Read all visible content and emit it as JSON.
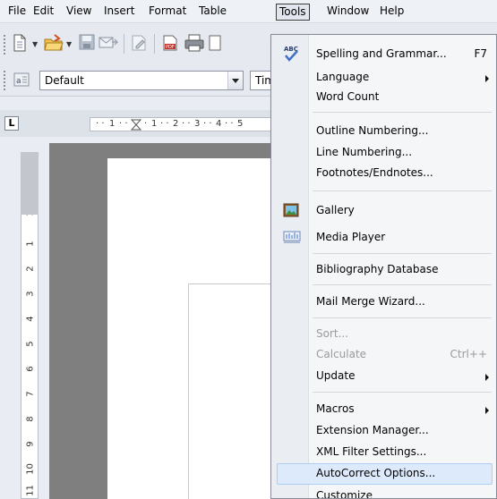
{
  "menubar": {
    "items": [
      "File",
      "Edit",
      "View",
      "Insert",
      "Format",
      "Table",
      "Tools",
      "Window",
      "Help"
    ],
    "active": "Tools"
  },
  "toolbar": {
    "style_value": "Default",
    "font_value": "Times I",
    "icons": [
      "new-document-icon",
      "open-folder-icon",
      "save-icon",
      "email-icon",
      "edit-file-icon",
      "export-pdf-icon",
      "print-icon",
      "spelling-icon"
    ]
  },
  "ruler": {
    "tab_selector": "L",
    "h_labels": [
      "1",
      "1",
      "2",
      "3",
      "4",
      "5"
    ],
    "v_labels": [
      "1",
      "1",
      "2",
      "3",
      "4",
      "5",
      "6",
      "7",
      "8",
      "9",
      "10",
      "11"
    ]
  },
  "tools_menu": {
    "items": [
      {
        "label": "Spelling and Grammar...",
        "shortcut": "F7",
        "icon": "spelling-icon"
      },
      {
        "label": "Language",
        "submenu": true
      },
      {
        "label": "Word Count"
      },
      {
        "label": "Outline Numbering..."
      },
      {
        "label": "Line Numbering..."
      },
      {
        "label": "Footnotes/Endnotes..."
      },
      {
        "label": "Gallery",
        "icon": "gallery-icon"
      },
      {
        "label": "Media Player",
        "icon": "media-player-icon"
      },
      {
        "label": "Bibliography Database"
      },
      {
        "label": "Mail Merge Wizard..."
      },
      {
        "label": "Sort...",
        "disabled": true
      },
      {
        "label": "Calculate",
        "shortcut": "Ctrl++",
        "disabled": true
      },
      {
        "label": "Update",
        "submenu": true
      },
      {
        "label": "Macros",
        "submenu": true
      },
      {
        "label": "Extension Manager..."
      },
      {
        "label": "XML Filter Settings..."
      },
      {
        "label": "AutoCorrect Options...",
        "highlighted": true
      },
      {
        "label": "Customize"
      }
    ]
  },
  "colors": {
    "menu_highlight": "#dceafb",
    "menu_highlight_border": "#aecdf3",
    "disabled_text": "#9a9a9a",
    "workspace_grey": "#7f7f7f"
  }
}
